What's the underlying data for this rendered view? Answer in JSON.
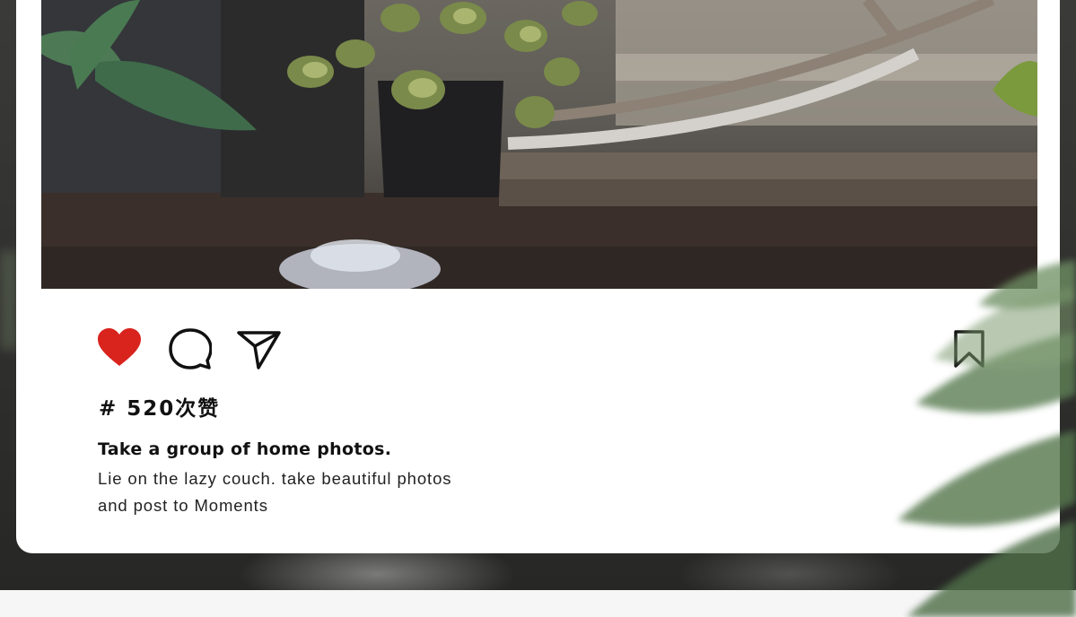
{
  "post": {
    "actions": {
      "like_icon": "heart-icon",
      "comment_icon": "comment-icon",
      "share_icon": "send-icon",
      "save_icon": "bookmark-icon",
      "like_color": "#d9231d"
    },
    "likes_text": "# 520次赞",
    "caption_title": "Take a group of home photos.",
    "caption_line_1": "Lie on the lazy couch. take beautiful photos",
    "caption_line_2": "and post to Moments"
  }
}
